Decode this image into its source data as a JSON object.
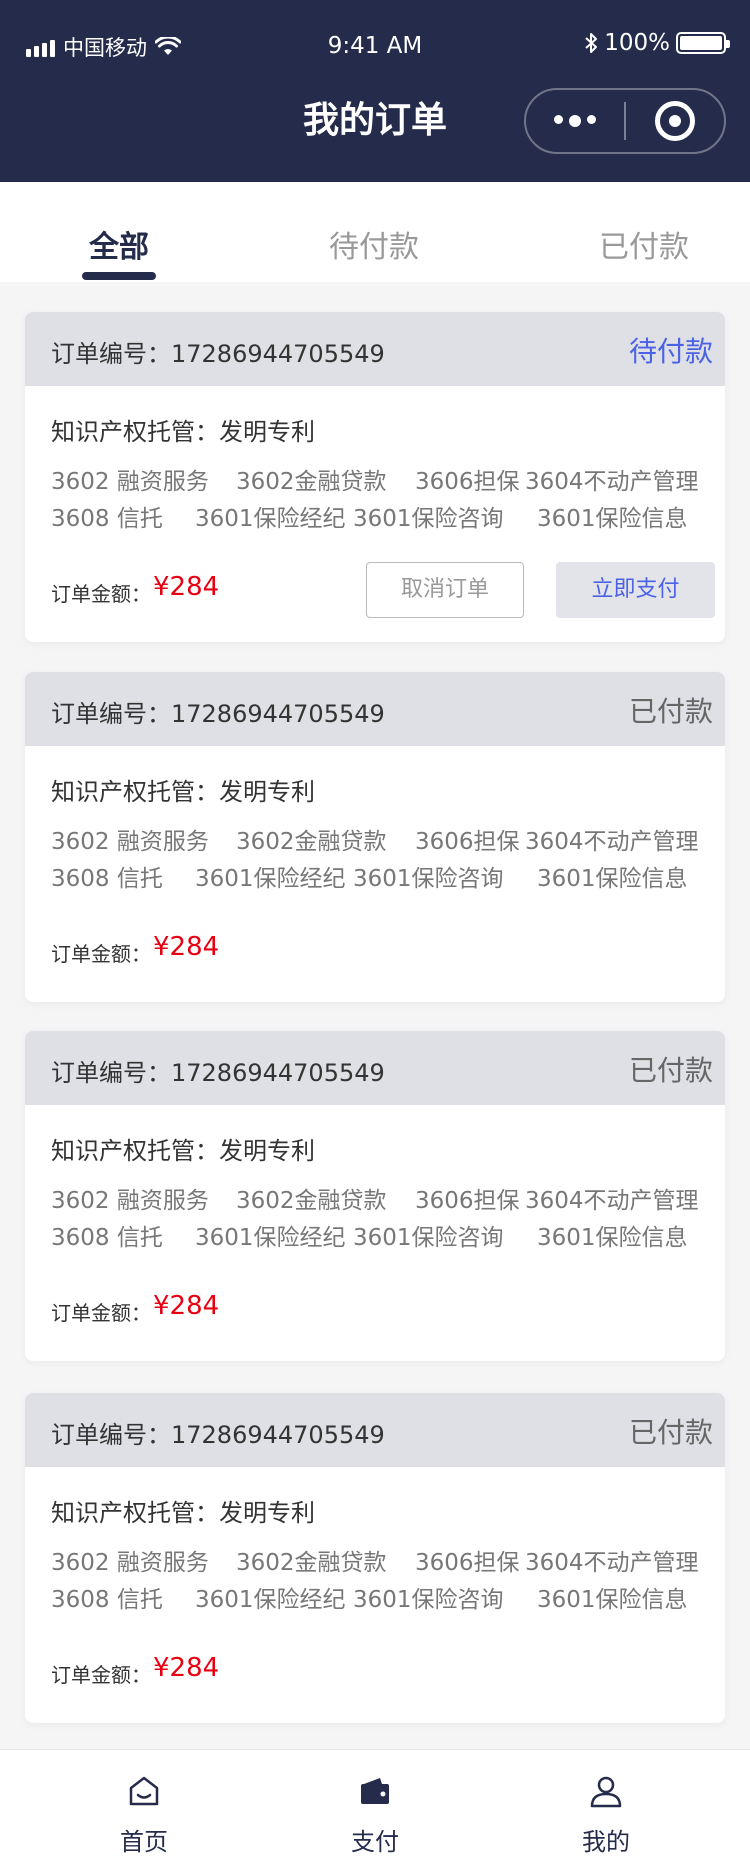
{
  "status_bar": {
    "carrier": "中国移动",
    "time": "9:41 AM",
    "battery": "100%"
  },
  "header": {
    "title": "我的订单"
  },
  "tabs": [
    {
      "label": "全部",
      "active": true
    },
    {
      "label": "待付款",
      "active": false
    },
    {
      "label": "已付款",
      "active": false
    }
  ],
  "orders": [
    {
      "order_no_label": "订单编号：",
      "order_no": "17286944705549",
      "status": "待付款",
      "service": "知识产权托管：发明专利",
      "tags_row1": [
        "3602 融资服务",
        "3602金融贷款",
        "3606担保",
        "3604不动产管理"
      ],
      "tags_row2": [
        "3608 信托",
        "3601保险经纪",
        "3601保险咨询",
        "3601保险信息"
      ],
      "amount_label": "订单金额：",
      "amount": "¥284",
      "cancel_label": "取消订单",
      "pay_label": "立即支付"
    },
    {
      "order_no_label": "订单编号：",
      "order_no": "17286944705549",
      "status": "已付款",
      "service": "知识产权托管：发明专利",
      "tags_row1": [
        "3602 融资服务",
        "3602金融贷款",
        "3606担保",
        "3604不动产管理"
      ],
      "tags_row2": [
        "3608 信托",
        "3601保险经纪",
        "3601保险咨询",
        "3601保险信息"
      ],
      "amount_label": "订单金额：",
      "amount": "¥284"
    },
    {
      "order_no_label": "订单编号：",
      "order_no": "17286944705549",
      "status": "已付款",
      "service": "知识产权托管：发明专利",
      "tags_row1": [
        "3602 融资服务",
        "3602金融贷款",
        "3606担保",
        "3604不动产管理"
      ],
      "tags_row2": [
        "3608 信托",
        "3601保险经纪",
        "3601保险咨询",
        "3601保险信息"
      ],
      "amount_label": "订单金额：",
      "amount": "¥284"
    },
    {
      "order_no_label": "订单编号：",
      "order_no": "17286944705549",
      "status": "已付款",
      "service": "知识产权托管：发明专利",
      "tags_row1": [
        "3602 融资服务",
        "3602金融贷款",
        "3606担保",
        "3604不动产管理"
      ],
      "tags_row2": [
        "3608 信托",
        "3601保险经纪",
        "3601保险咨询",
        "3601保险信息"
      ],
      "amount_label": "订单金额：",
      "amount": "¥284"
    }
  ],
  "tabbar": [
    {
      "label": "首页",
      "icon": "home-icon"
    },
    {
      "label": "支付",
      "icon": "wallet-icon"
    },
    {
      "label": "我的",
      "icon": "user-icon"
    }
  ],
  "colors": {
    "header_bg": "#252c4b",
    "accent_blue": "#4c62e6",
    "price_red": "#e60012",
    "card_head_bg": "#dfe0e5"
  }
}
